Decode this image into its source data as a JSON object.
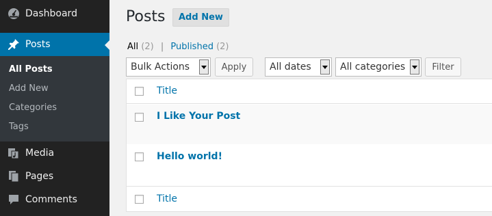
{
  "sidebar": {
    "items": [
      {
        "label": "Dashboard",
        "icon": "dashboard-icon"
      },
      {
        "label": "Posts",
        "icon": "pushpin-icon",
        "active": true
      },
      {
        "label": "Media",
        "icon": "media-icon"
      },
      {
        "label": "Pages",
        "icon": "pages-icon"
      },
      {
        "label": "Comments",
        "icon": "comments-icon"
      }
    ],
    "submenu": [
      {
        "label": "All Posts",
        "current": true
      },
      {
        "label": "Add New"
      },
      {
        "label": "Categories"
      },
      {
        "label": "Tags"
      }
    ]
  },
  "main": {
    "title": "Posts",
    "add_new_label": "Add New",
    "filters": {
      "all_label": "All",
      "all_count": "(2)",
      "separator": "|",
      "published_label": "Published",
      "published_count": "(2)"
    },
    "bulk_actions": {
      "selected": "Bulk Actions"
    },
    "apply_label": "Apply",
    "dates_filter": {
      "selected": "All dates"
    },
    "categories_filter": {
      "selected": "All categories"
    },
    "filter_label": "Filter",
    "table": {
      "column_title": "Title",
      "rows": [
        {
          "title": "I Like Your Post"
        },
        {
          "title": "Hello world!"
        }
      ],
      "footer_title": "Title"
    }
  },
  "colors": {
    "sidebar_bg": "#222222",
    "submenu_bg": "#32373c",
    "active_bg": "#0073aa",
    "link": "#0073aa",
    "page_bg": "#f1f1f1"
  }
}
